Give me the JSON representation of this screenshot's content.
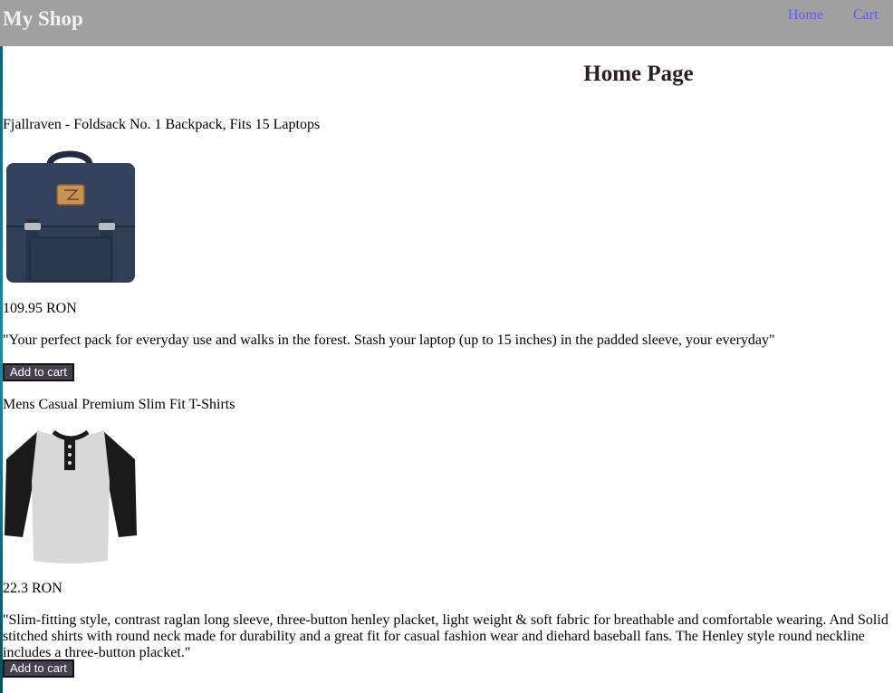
{
  "header": {
    "brand": "My Shop",
    "nav": [
      {
        "label": "Home"
      },
      {
        "label": "Cart"
      }
    ]
  },
  "page": {
    "title": "Home Page"
  },
  "products": [
    {
      "title": "Fjallraven - Foldsack No. 1 Backpack, Fits 15 Laptops",
      "image_icon": "backpack-image",
      "price": "109.95 RON",
      "description": "\"Your perfect pack for everyday use and walks in the forest. Stash your laptop (up to 15 inches) in the padded sleeve, your everyday\"",
      "button_label": "Add to cart"
    },
    {
      "title": "Mens Casual Premium Slim Fit T-Shirts",
      "image_icon": "henley-shirt-image",
      "price": "22.3 RON",
      "description": "\"Slim-fitting style, contrast raglan long sleeve, three-button henley placket, light weight & soft fabric for breathable and comfortable wearing. And Solid stitched shirts with round neck made for durability and a great fit for casual fashion wear and diehard baseball fans. The Henley style round neckline includes a three-button placket.\"",
      "button_label": "Add to cart"
    }
  ],
  "colors": {
    "navbar_bg": "#a0a0a0",
    "brand_text": "#f2f2f2",
    "nav_link": "#5a5aff",
    "button_bg": "#463f50",
    "backpack": "#2f3d55",
    "shirt_body": "#d8d8d8",
    "shirt_sleeves": "#1a1a1a"
  }
}
